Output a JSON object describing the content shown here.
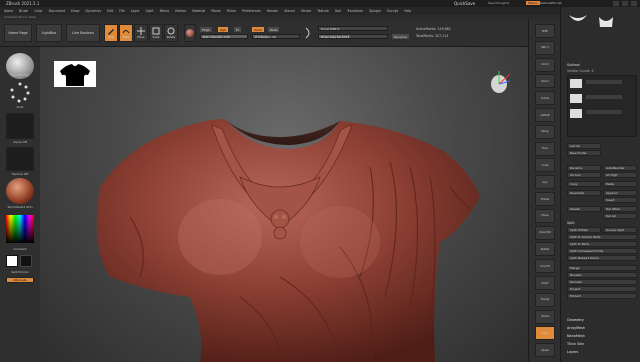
{
  "titlebar": {
    "app_title": "ZBrush 2021.5.1",
    "quicksave": "QuickSave",
    "see_through": "See-through  0",
    "menus_tag": "Menus",
    "script": "DefaultZScript"
  },
  "menubar": {
    "items": [
      "Alpha",
      "Brush",
      "Color",
      "Document",
      "Draw",
      "Dynamics",
      "Edit",
      "File",
      "Layer",
      "Light",
      "Macro",
      "Marker",
      "Material",
      "Movie",
      "Picker",
      "Preferences",
      "Render",
      "Stencil",
      "Stroke",
      "Texture",
      "Tool",
      "Transform",
      "Zplugin",
      "Zscript",
      "Help"
    ]
  },
  "subline": "Indicates Mirror state",
  "toolbar": {
    "home_page": "Home Page",
    "lightbox": "LightBox",
    "live_boolean": "Live Boolean",
    "edit": "Edit",
    "draw": "Draw",
    "move": "Move",
    "scale": "Scale",
    "rotate": "Rotate",
    "mrgb": "Mrgb",
    "rgb": "Rgb",
    "m": "M",
    "zadd": "Zadd",
    "zsub": "Zsub",
    "rgb_intensity": "Rgb Intensity",
    "rgb_intensity_value": "100",
    "rgb_intensity_pct": 1.0,
    "z_intensity": "Z Intensity",
    "z_intensity_value": "30",
    "z_intensity_pct": 0.3,
    "focal_shift": "Focal Shift 0",
    "draw_size": "Draw Size 64.4073",
    "draw_size_pct": 0.45,
    "dynamic": "Dynamic",
    "active_points": "ActivePoints: 129,982",
    "total_points": "TotalPoints: 207,114"
  },
  "leftpanel": {
    "brush_label": "Clay Buildup",
    "stroke_label": "Dots",
    "alpha_label": "Alpha Off",
    "texture_label": "Texture Off",
    "material_label": "SkinShade4 Skin",
    "gradient_label": "Gradient",
    "switch_color": "SwitchColor",
    "alternate": "Alternate"
  },
  "rightstrip": {
    "buttons": [
      "BPR",
      "SPix 3",
      "Scroll",
      "Zoom",
      "Actual",
      "AAHalf",
      "Persp",
      "Floor",
      "Local",
      "Gyz",
      "Frame",
      "Move",
      "Zoom3D",
      "Rotate",
      "Line Fill",
      "PolyF",
      "Transp",
      "Ghost",
      "Solo",
      "Xpose"
    ]
  },
  "rightpanel": {
    "subtool_title": "Subtool",
    "visible_count": "Visible Count: 4",
    "list_all": "List All",
    "new_folder": "New Folder",
    "rename": "Rename",
    "autoreorder": "AutoReorder",
    "all_low": "All Low",
    "all_high": "All High",
    "copy": "Copy",
    "paste": "Paste",
    "duplicate": "Duplicate",
    "append": "Append",
    "insert": "Insert",
    "delete": "Delete",
    "del_other": "Del Other",
    "del_all": "Del All",
    "split_title": "Split",
    "split_hidden": "Split Hidden",
    "groups_split": "Groups Split",
    "split_similar": "Split To Similar Parts",
    "split_parts": "Split To Parts",
    "split_unmasked": "Split Unmasked Points",
    "split_masked": "Split Masked Points",
    "merge": "Merge",
    "boolean": "Boolean",
    "remesh": "Remesh",
    "project": "Project",
    "extract": "Extract",
    "geometry": "Geometry",
    "arraymesh": "ArrayMesh",
    "nanomesh": "NanoMesh",
    "thick_skin": "Thick Skin",
    "layers": "Layers"
  }
}
